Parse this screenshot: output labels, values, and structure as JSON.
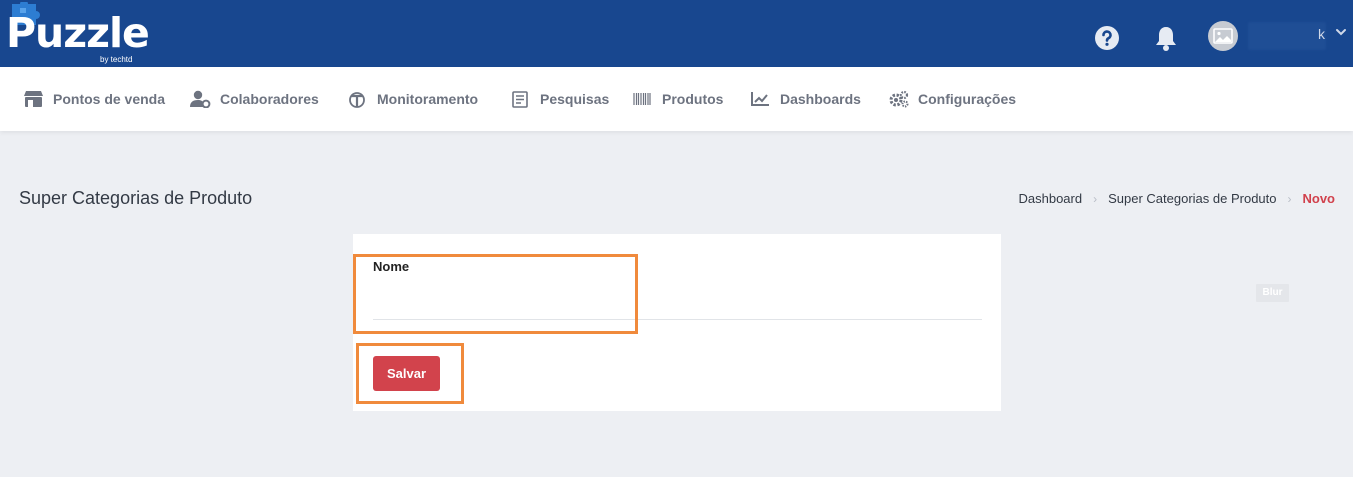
{
  "app": {
    "logo_text": "Puzzle",
    "logo_sub": "by techtd"
  },
  "topbar": {
    "help_icon": "question-circle-icon",
    "bell_icon": "bell-icon",
    "avatar_icon": "image-placeholder-icon",
    "username": "",
    "caret": "k"
  },
  "nav": {
    "items": [
      {
        "label": "Pontos de venda",
        "icon": "store-icon"
      },
      {
        "label": "Colaboradores",
        "icon": "user-gear-icon"
      },
      {
        "label": "Monitoramento",
        "icon": "monitor-icon"
      },
      {
        "label": "Pesquisas",
        "icon": "survey-icon"
      },
      {
        "label": "Produtos",
        "icon": "barcode-icon"
      },
      {
        "label": "Dashboards",
        "icon": "line-chart-icon"
      },
      {
        "label": "Configurações",
        "icon": "gears-icon"
      }
    ]
  },
  "page": {
    "title": "Super Categorias de Produto",
    "breadcrumb": [
      "Dashboard",
      "Super Categorias de Produto",
      "Novo"
    ]
  },
  "form": {
    "name_label": "Nome",
    "name_value": "",
    "name_placeholder": "",
    "save_label": "Salvar"
  },
  "overlay": {
    "blur_label": "Blur"
  },
  "colors": {
    "header": "#18478f",
    "accent": "#d2434c",
    "highlight": "#f08a3c",
    "background": "#edeff3"
  }
}
